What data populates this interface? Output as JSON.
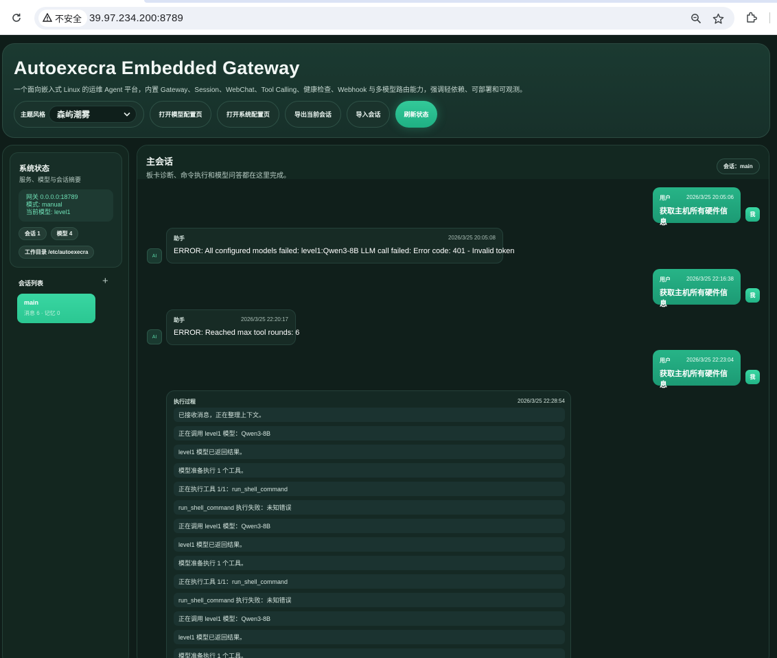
{
  "browser": {
    "security_label": "不安全",
    "url": "39.97.234.200:8789"
  },
  "header": {
    "title": "Autoexecra Embedded Gateway",
    "subtitle": "一个面向嵌入式 Linux 的运维 Agent 平台，内置 Gateway、Session、WebChat、Tool Calling、健康检查、Webhook 与多模型路由能力，强调轻依赖、可部署和可观测。",
    "theme_label": "主题风格",
    "theme_value": "森屿潮雾",
    "buttons": {
      "open_model_config": "打开模型配置页",
      "open_system_config": "打开系统配置页",
      "export_session": "导出当前会话",
      "import_session": "导入会话",
      "refresh_status": "刷新状态"
    }
  },
  "sidebar": {
    "status_title": "系统状态",
    "status_subtitle": "服务、模型与会话摘要",
    "gateway_line": "网关 0.0.0.0:18789",
    "mode_line": "模式: manual",
    "current_model_line": "当前模型: level1",
    "chip_sessions": "会话 1",
    "chip_models": "模型 4",
    "chip_workdir": "工作目录 /etc/autoexecra",
    "sessions_title": "会话列表",
    "add_symbol": "+",
    "sessions": [
      {
        "name": "main",
        "meta": "消息 6 · 记忆 0"
      }
    ]
  },
  "chat": {
    "title": "主会话",
    "subtitle": "板卡诊断、命令执行和模型问答都在这里完成。",
    "session_badge": "会话：main",
    "user_avatar": "我",
    "ai_avatar": "AI",
    "messages": [
      {
        "role": "用户",
        "time": "2026/3/25 20:05:06",
        "text": "获取主机所有硬件信息"
      },
      {
        "role": "助手",
        "time": "2026/3/25 20:05:08",
        "text": "ERROR: All configured models failed: level1:Qwen3-8B LLM call failed: Error code: 401 - Invalid token"
      },
      {
        "role": "用户",
        "time": "2026/3/25 22:16:38",
        "text": "获取主机所有硬件信息"
      },
      {
        "role": "助手",
        "time": "2026/3/25 22:20:17",
        "text": "ERROR: Reached max tool rounds: 6"
      },
      {
        "role": "用户",
        "time": "2026/3/25 22:23:04",
        "text": "获取主机所有硬件信息"
      }
    ],
    "exec": {
      "label": "执行过程",
      "time": "2026/3/25 22:28:54",
      "steps": [
        "已接收消息，正在整理上下文。",
        "正在调用 level1 模型：Qwen3-8B",
        "level1 模型已返回结果。",
        "模型准备执行 1 个工具。",
        "正在执行工具 1/1：run_shell_command",
        "run_shell_command 执行失败：未知错误",
        "正在调用 level1 模型：Qwen3-8B",
        "level1 模型已返回结果。",
        "模型准备执行 1 个工具。",
        "正在执行工具 1/1：run_shell_command",
        "run_shell_command 执行失败：未知错误",
        "正在调用 level1 模型：Qwen3-8B",
        "level1 模型已返回结果。",
        "模型准备执行 1 个工具。"
      ]
    }
  }
}
